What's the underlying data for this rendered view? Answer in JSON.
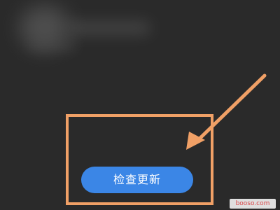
{
  "button": {
    "label": "检查更新"
  },
  "watermark": {
    "text": "booso.com"
  },
  "colors": {
    "background": "#2a2a2a",
    "button": "#3b86e6",
    "highlight": "#f0a066"
  },
  "icons": {
    "arrow": "arrow-pointing-down-left-icon"
  }
}
